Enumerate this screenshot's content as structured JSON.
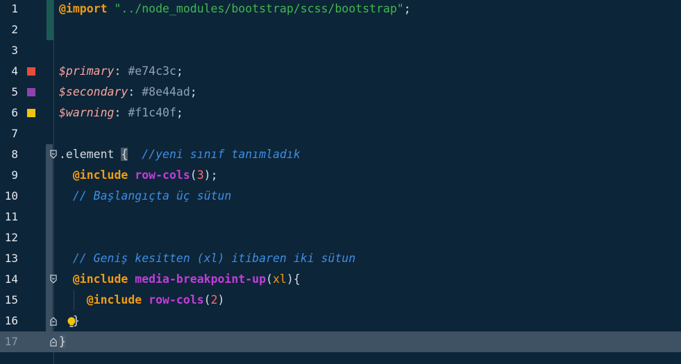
{
  "editor": {
    "lines": [
      {
        "num": "1",
        "tokens": [
          {
            "t": "@import",
            "c": "kw"
          },
          {
            "t": " ",
            "c": "punc"
          },
          {
            "t": "\"../node_modules/bootstrap/scss/bootstrap\"",
            "c": "str"
          },
          {
            "t": ";",
            "c": "punc"
          }
        ]
      },
      {
        "num": "2",
        "tokens": []
      },
      {
        "num": "3",
        "tokens": []
      },
      {
        "num": "4",
        "swatch": "#e74c3c",
        "tokens": [
          {
            "t": "$primary",
            "c": "var"
          },
          {
            "t": ": ",
            "c": "punc"
          },
          {
            "t": "#e74c3c",
            "c": "hex"
          },
          {
            "t": ";",
            "c": "punc"
          }
        ]
      },
      {
        "num": "5",
        "swatch": "#8e44ad",
        "tokens": [
          {
            "t": "$secondary",
            "c": "var"
          },
          {
            "t": ": ",
            "c": "punc"
          },
          {
            "t": "#8e44ad",
            "c": "hex"
          },
          {
            "t": ";",
            "c": "punc"
          }
        ]
      },
      {
        "num": "6",
        "swatch": "#f1c40f",
        "tokens": [
          {
            "t": "$warning",
            "c": "var"
          },
          {
            "t": ": ",
            "c": "punc"
          },
          {
            "t": "#f1c40f",
            "c": "hex"
          },
          {
            "t": ";",
            "c": "punc"
          }
        ]
      },
      {
        "num": "7",
        "tokens": []
      },
      {
        "num": "8",
        "fold": "open",
        "tokens": [
          {
            "t": ".element ",
            "c": "sel"
          },
          {
            "t": "{",
            "c": "brace-hl"
          },
          {
            "t": "  ",
            "c": "punc"
          },
          {
            "t": "//yeni sınıf tanımladık",
            "c": "cmt"
          }
        ]
      },
      {
        "num": "9",
        "tokens": [
          {
            "t": "  ",
            "c": "punc"
          },
          {
            "t": "@include",
            "c": "kw"
          },
          {
            "t": " ",
            "c": "punc"
          },
          {
            "t": "row-cols",
            "c": "fn"
          },
          {
            "t": "(",
            "c": "punc"
          },
          {
            "t": "3",
            "c": "num"
          },
          {
            "t": ");",
            "c": "punc"
          }
        ]
      },
      {
        "num": "10",
        "tokens": [
          {
            "t": "  ",
            "c": "punc"
          },
          {
            "t": "// Başlangıçta üç sütun",
            "c": "cmt"
          }
        ]
      },
      {
        "num": "11",
        "tokens": []
      },
      {
        "num": "12",
        "tokens": []
      },
      {
        "num": "13",
        "tokens": [
          {
            "t": "  ",
            "c": "punc"
          },
          {
            "t": "// Geniş kesitten (xl) itibaren iki sütun",
            "c": "cmt"
          }
        ]
      },
      {
        "num": "14",
        "fold": "open",
        "tokens": [
          {
            "t": "  ",
            "c": "punc"
          },
          {
            "t": "@include",
            "c": "kw"
          },
          {
            "t": " ",
            "c": "punc"
          },
          {
            "t": "media-breakpoint-up",
            "c": "fn"
          },
          {
            "t": "(",
            "c": "punc"
          },
          {
            "t": "xl",
            "c": "arg"
          },
          {
            "t": "){",
            "c": "punc"
          }
        ]
      },
      {
        "num": "15",
        "tokens": [
          {
            "t": "    ",
            "c": "punc"
          },
          {
            "t": "@include",
            "c": "kw"
          },
          {
            "t": " ",
            "c": "punc"
          },
          {
            "t": "row-cols",
            "c": "fn"
          },
          {
            "t": "(",
            "c": "punc"
          },
          {
            "t": "2",
            "c": "num"
          },
          {
            "t": ")",
            "c": "punc"
          }
        ]
      },
      {
        "num": "16",
        "fold": "close",
        "bulb": true,
        "tokens": [
          {
            "t": "  ",
            "c": "punc"
          },
          {
            "t": "}",
            "c": "punc"
          }
        ]
      },
      {
        "num": "17",
        "fold": "close",
        "current": true,
        "tokens": [
          {
            "t": "}",
            "c": "brace-hl"
          }
        ]
      }
    ]
  }
}
